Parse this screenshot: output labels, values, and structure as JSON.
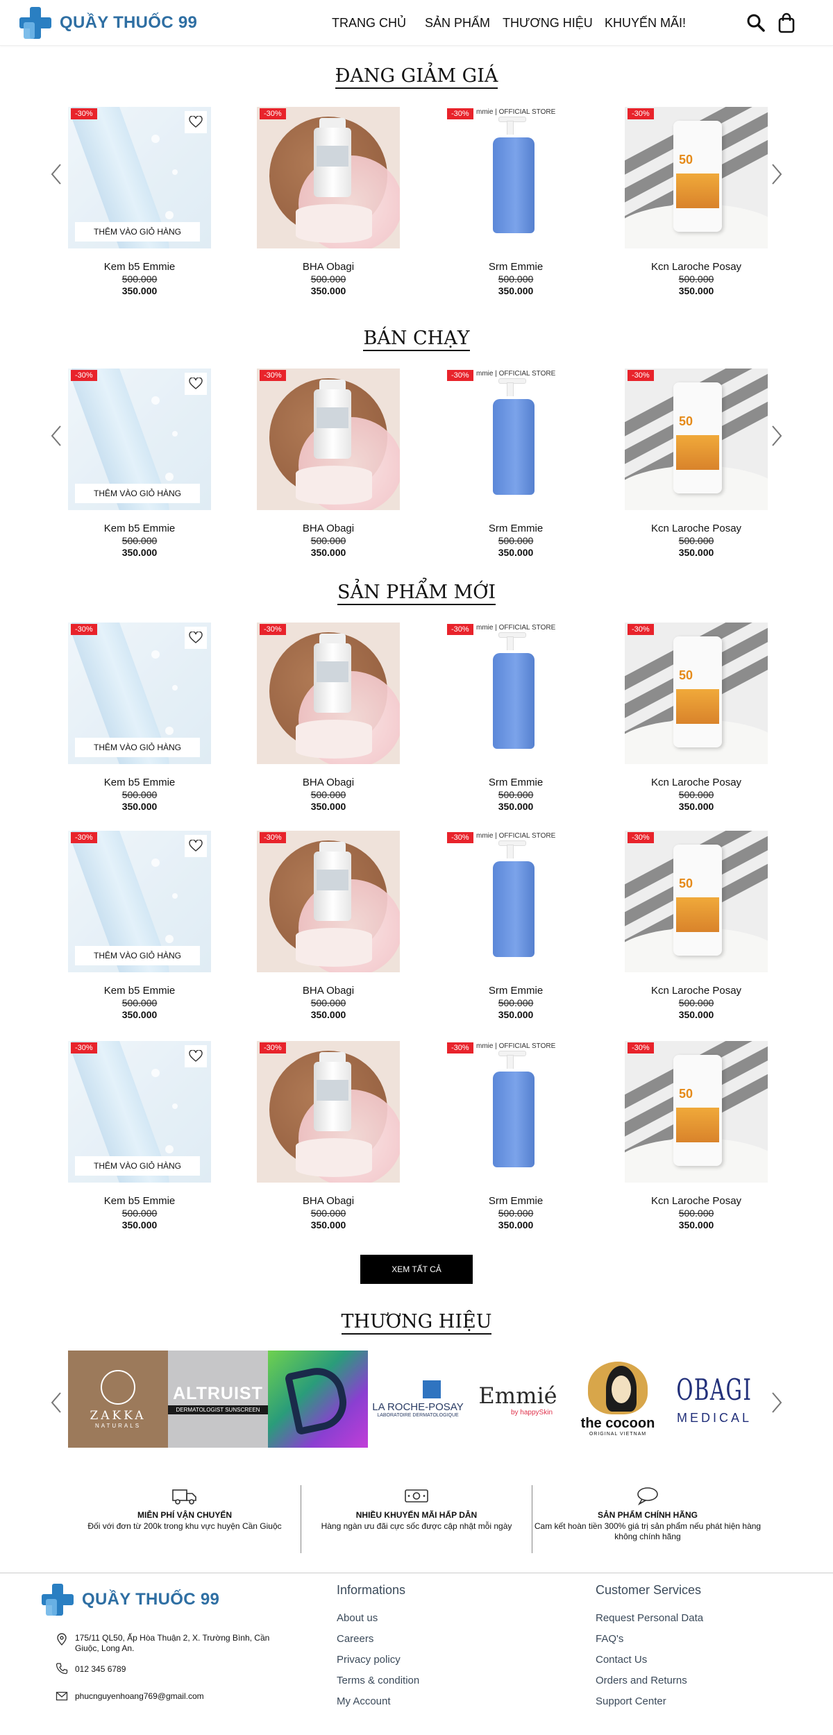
{
  "brand": {
    "name": "QUẦY THUỐC 99"
  },
  "nav": [
    "TRANG CHỦ",
    "SẢN PHẨM",
    "THƯƠNG HIỆU",
    "KHUYẾN MÃI!"
  ],
  "sections": [
    "ĐANG GIẢM GIÁ",
    "BÁN CHẠY",
    "SẢN PHẨM MỚI"
  ],
  "card": {
    "badge": "-30%",
    "add_to_cart": "THÊM VÀO GIỎ HÀNG",
    "store_label": "mmie | OFFICIAL STORE"
  },
  "products": [
    {
      "name": "Kem b5 Emmie",
      "old_price": "500.000",
      "new_price": "350.000",
      "art": "kem"
    },
    {
      "name": "BHA Obagi",
      "old_price": "500.000",
      "new_price": "350.000",
      "art": "bha"
    },
    {
      "name": "Srm Emmie",
      "old_price": "500.000",
      "new_price": "350.000",
      "art": "srm"
    },
    {
      "name": "Kcn Laroche Posay",
      "old_price": "500.000",
      "new_price": "350.000",
      "art": "lrp"
    }
  ],
  "view_all": "XEM TẤT CẢ",
  "brands_title": "THƯƠNG HIỆU",
  "brands": [
    {
      "name": "ZAKKA",
      "sub": "NATURALS",
      "bg": "#9c7a5b"
    },
    {
      "name": "ALTRUIST",
      "sub": "DERMATOLOGIST SUNSCREEN",
      "bg": "#c8c8c8"
    },
    {
      "name": "",
      "sub": "",
      "bg": "#5ec447"
    },
    {
      "name": "LA ROCHE-POSAY",
      "sub": "LABORATOIRE DERMATOLOGIQUE",
      "bg": "#ffffff"
    },
    {
      "name": "Emmié",
      "sub": "by happySkin",
      "bg": "#ffffff"
    },
    {
      "name": "the cocoon",
      "sub": "ORIGINAL VIETNAM",
      "bg": "#ffffff"
    },
    {
      "name": "OBAGI",
      "sub": "MEDICAL",
      "bg": "#ffffff"
    }
  ],
  "features": [
    {
      "title": "MIỄN PHÍ VẬN CHUYỂN",
      "desc": "Đối với đơn từ 200k trong khu vực huyện Cần Giuộc",
      "icon": "truck-icon"
    },
    {
      "title": "NHIỀU KHUYẾN MÃI HẤP DẪN",
      "desc": "Hàng ngàn ưu đãi cực sốc được cập nhật mỗi ngày",
      "icon": "money-icon"
    },
    {
      "title": "SẢN PHẨM CHÍNH HÃNG",
      "desc": "Cam kết hoàn tiền 300% giá trị sản phẩm nếu phát hiện hàng không chính hãng",
      "icon": "chat-icon"
    }
  ],
  "footer": {
    "address": "175/11 QL50, Ấp Hòa Thuận 2, X. Trường Bình, Cần Giuộc, Long An.",
    "phone": "012 345 6789",
    "email": "phucnguyenhoang769@gmail.com",
    "info_title": "Informations",
    "info_links": [
      "About us",
      "Careers",
      "Privacy policy",
      "Terms & condition",
      "My Account"
    ],
    "cs_title": "Customer Services",
    "cs_links": [
      "Request Personal Data",
      "FAQ's",
      "Contact Us",
      "Orders and Returns",
      "Support Center"
    ]
  },
  "colors": {
    "accent": "#2f6fa3",
    "badge": "#e8232b"
  }
}
